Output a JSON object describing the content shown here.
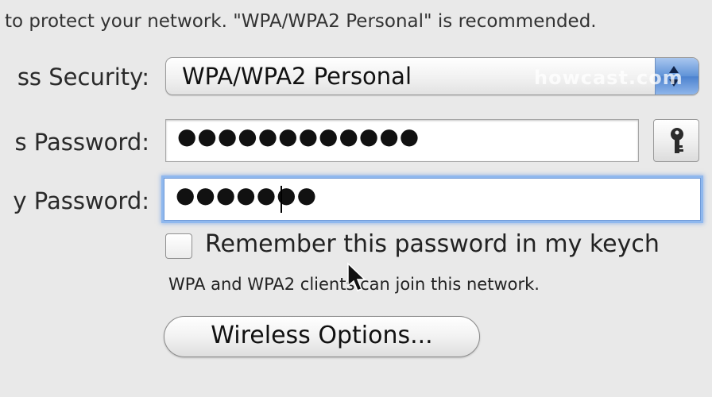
{
  "info": {
    "text": "to protect your network. \"WPA/WPA2 Personal\" is recommended."
  },
  "security": {
    "label": "ss Security:",
    "value": "WPA/WPA2 Personal",
    "stepper_icon": "up-down-arrows-icon"
  },
  "watermark": {
    "text": "howcast.com"
  },
  "password": {
    "label": "s Password:",
    "masked_value": "●●●●●●●●●●●●",
    "key_icon": "key-icon"
  },
  "verify": {
    "label": "y Password:",
    "masked_value": "●●●●●●●"
  },
  "remember": {
    "label": "Remember this password in my keych",
    "checked": false
  },
  "note": {
    "text": "WPA and WPA2 clients can join this network."
  },
  "wireless_options": {
    "label": "Wireless Options..."
  },
  "colors": {
    "background": "#e9e9e9",
    "focus_ring": "#8fb8ee",
    "stepper_blue": "#5f93d8"
  }
}
